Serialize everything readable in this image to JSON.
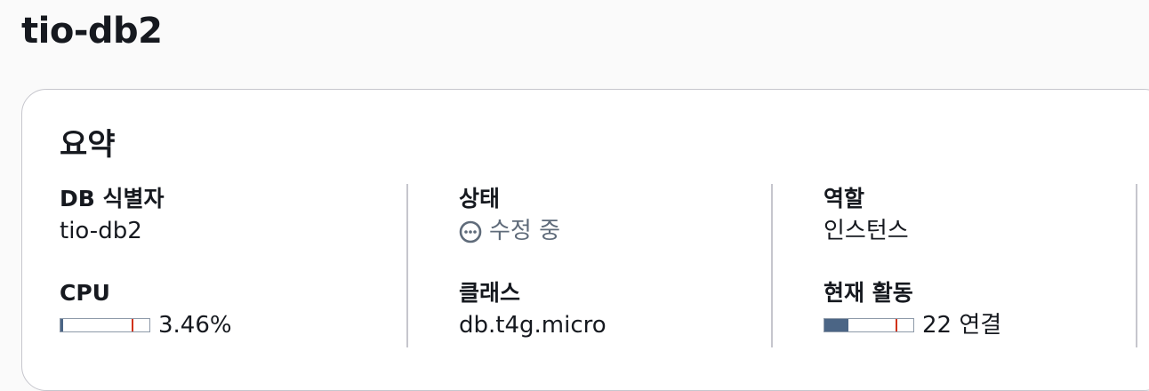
{
  "page": {
    "title": "tio-db2"
  },
  "summary": {
    "title": "요약",
    "db_identifier": {
      "label": "DB 식별자",
      "value": "tio-db2"
    },
    "cpu": {
      "label": "CPU",
      "value": "3.46%",
      "fill_fraction": 0.0346
    },
    "status": {
      "label": "상태",
      "value": "수정 중",
      "icon": "in-progress-icon"
    },
    "class": {
      "label": "클래스",
      "value": "db.t4g.micro"
    },
    "role": {
      "label": "역할",
      "value": "인스턴스"
    },
    "current_activity": {
      "label": "현재 활동",
      "value": "22 연결",
      "fill_fraction": 0.27
    }
  },
  "colors": {
    "meter_fill": "#4b6585",
    "meter_threshold": "#d13212",
    "status_text": "#5f6b7a"
  }
}
